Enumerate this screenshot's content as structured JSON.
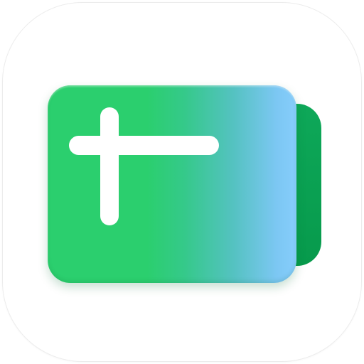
{
  "icon": {
    "name": "add-card-app-icon",
    "colors": {
      "tile_background": "#ffffff",
      "back_card": "#0ea859",
      "front_card_green": "#2bcf6e",
      "front_card_blue": "#86cdfc",
      "plus_mark": "#ffffff"
    }
  }
}
